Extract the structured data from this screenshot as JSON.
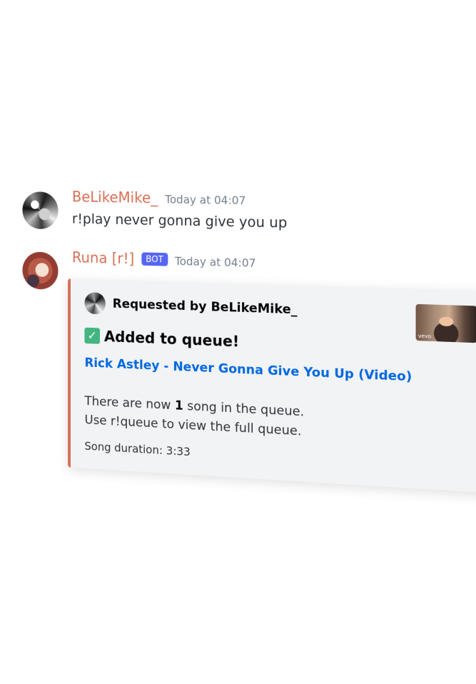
{
  "messages": [
    {
      "username": "BeLikeMike_",
      "timestamp": "Today at 04:07",
      "content": "r!play never gonna give you up"
    },
    {
      "username": "Runa [r!]",
      "bot_tag": "BOT",
      "timestamp": "Today at 04:07",
      "embed": {
        "author": "Requested by BeLikeMike_",
        "title": "Added to queue!",
        "title_icon": "check-mark-icon",
        "link_text": "Rick Astley - Never Gonna Give You Up (Video)",
        "desc_line1_pre": "There are now ",
        "desc_line1_count": "1",
        "desc_line1_post": " song in the queue.",
        "desc_line2": "Use r!queue to view the full queue.",
        "footer": "Song duration: 3:33",
        "thumbnail_label": "vevo"
      }
    }
  ],
  "colors": {
    "username": "#d86f55",
    "bot_tag": "#5865f2",
    "link": "#0068e0",
    "embed_border": "#d86f55",
    "embed_bg": "#f2f3f5"
  }
}
